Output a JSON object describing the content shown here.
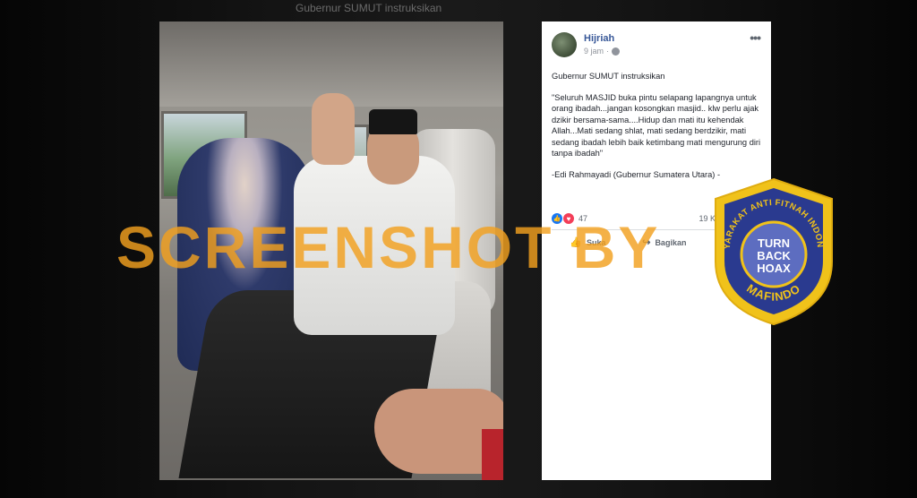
{
  "background_text": "Gubernur SUMUT instruksikan",
  "post": {
    "author": "Hijriah",
    "time": "9 jam",
    "more_icon": "more-horizontal-icon",
    "intro": "Gubernur SUMUT instruksikan",
    "quote": "\"Seluruh MASJID buka pintu selapang lapangnya untuk orang ibadah...jangan kosongkan masjid.. klw perlu ajak dzikir bersama-sama....Hidup dan mati itu kehendak Allah...Mati sedang shlat, mati sedang berdzikir, mati sedang ibadah lebih baik ketimbang mati mengurung diri tanpa ibadah\"",
    "attribution": "-Edi Rahmayadi (Gubernur Sumatera Utara) -",
    "reaction_count": "47",
    "shares": "19 Kali dibagikan",
    "actions": {
      "like": "Suka",
      "share": "Bagikan"
    }
  },
  "watermark": "SCREENSHOT BY",
  "badge": {
    "top_text": "MASYARAKAT ANTI FITNAH INDONESIA",
    "bottom_text": "MAFINDO",
    "logo_lines": [
      "TURN",
      "BACK",
      "HOAX"
    ]
  },
  "colors": {
    "link": "#385898",
    "watermark": "#f2a01e",
    "badge_blue": "#2a3a8f",
    "badge_gold": "#f0c21a"
  }
}
